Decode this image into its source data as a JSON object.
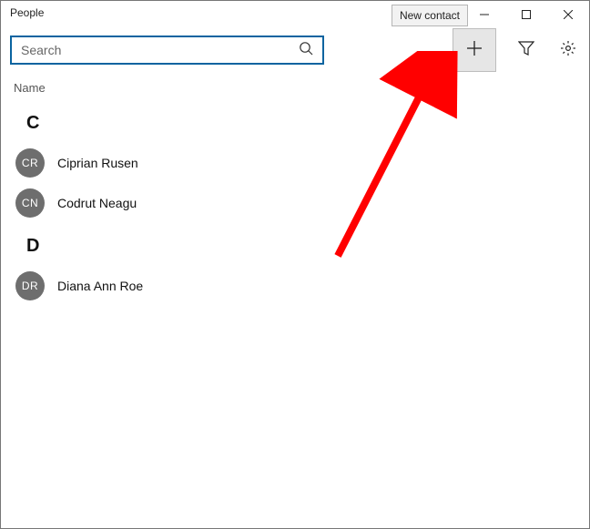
{
  "app": {
    "title": "People"
  },
  "tooltip": {
    "new_contact": "New contact"
  },
  "search": {
    "placeholder": "Search"
  },
  "list": {
    "column_header": "Name",
    "groups": {
      "c": {
        "letter": "C"
      },
      "d": {
        "letter": "D"
      }
    },
    "contacts": {
      "ciprian": {
        "initials": "CR",
        "name": "Ciprian Rusen"
      },
      "codrut": {
        "initials": "CN",
        "name": "Codrut Neagu"
      },
      "diana": {
        "initials": "DR",
        "name": "Diana Ann Roe"
      }
    }
  },
  "colors": {
    "accent": "#0a64a0",
    "avatar_bg": "#6e6e6e",
    "arrow": "#ff0000"
  }
}
